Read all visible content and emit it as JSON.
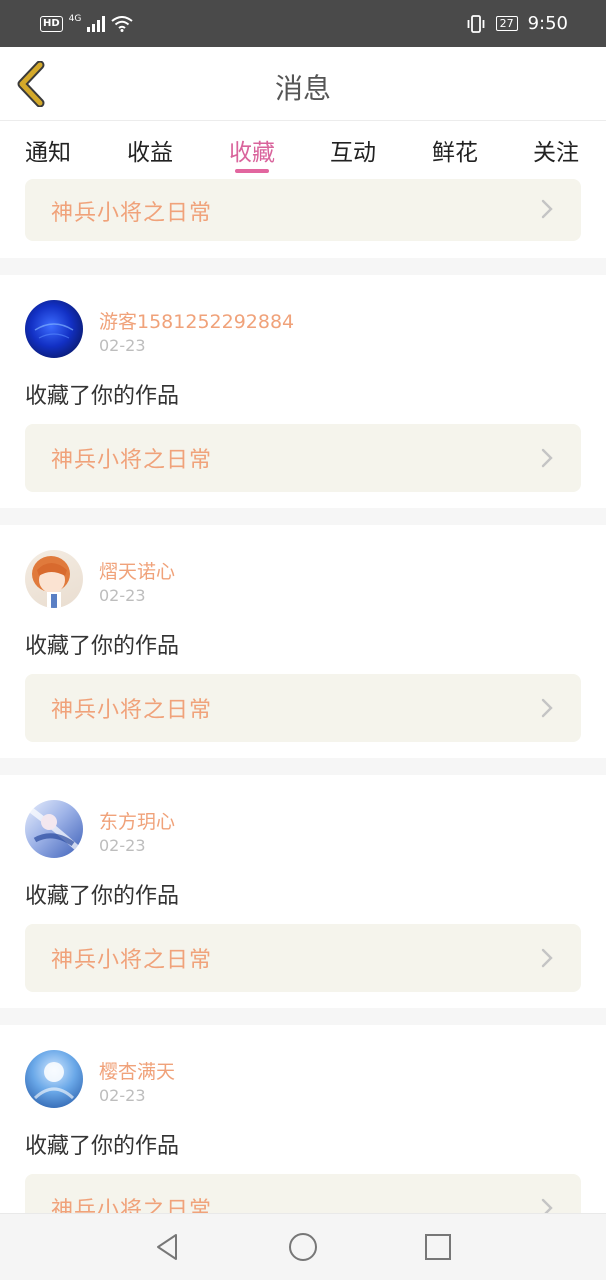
{
  "status_bar": {
    "hd": "HD",
    "network": "4G",
    "battery": "27",
    "time": "9:50"
  },
  "header": {
    "title": "消息"
  },
  "tabs": [
    {
      "label": "通知"
    },
    {
      "label": "收益"
    },
    {
      "label": "收藏",
      "active": true
    },
    {
      "label": "互动"
    },
    {
      "label": "鲜花"
    },
    {
      "label": "关注"
    }
  ],
  "messages": [
    {
      "work_title": "神兵小将之日常"
    },
    {
      "username": "游客1581252292884",
      "date": "02-23",
      "action": "收藏了你的作品",
      "work_title": "神兵小将之日常"
    },
    {
      "username": "熠天诺心",
      "date": "02-23",
      "action": "收藏了你的作品",
      "work_title": "神兵小将之日常"
    },
    {
      "username": "东方玥心",
      "date": "02-23",
      "action": "收藏了你的作品",
      "work_title": "神兵小将之日常"
    },
    {
      "username": "樱杏满天",
      "date": "02-23",
      "action": "收藏了你的作品",
      "work_title": "神兵小将之日常"
    }
  ],
  "icons": {
    "back": "chevron-left-icon",
    "arrow": "chevron-right-icon",
    "nav_back": "triangle-back-icon",
    "nav_home": "circle-home-icon",
    "nav_recents": "square-recents-icon"
  },
  "colors": {
    "accent": "#e2669f",
    "username": "#f0a27a",
    "card_bg": "#f5f4ec",
    "back_icon": "#d4a92a"
  }
}
